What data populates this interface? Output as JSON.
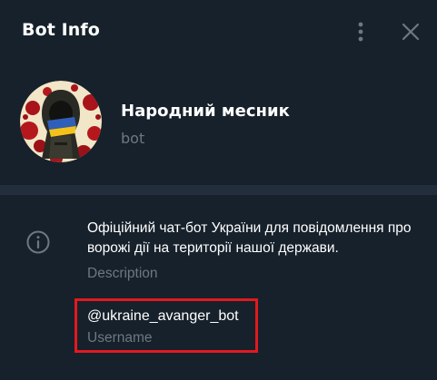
{
  "header": {
    "title": "Bot Info",
    "more_icon": "more-vertical-icon",
    "close_icon": "close-icon"
  },
  "profile": {
    "name": "Народний месник",
    "subtitle": "bot",
    "avatar_icon": "avatar-image"
  },
  "info": {
    "icon": "info-icon",
    "description": "Офіційний чат-бот України для повідомлення про ворожі дії на території нашої держави.",
    "description_label": "Description",
    "username": "@ukraine_avanger_bot",
    "username_label": "Username"
  },
  "colors": {
    "background": "#17212b",
    "divider": "#232e3c",
    "secondary_text": "#6c7883",
    "primary_text": "#ffffff",
    "highlight_border": "#e01a1f"
  }
}
